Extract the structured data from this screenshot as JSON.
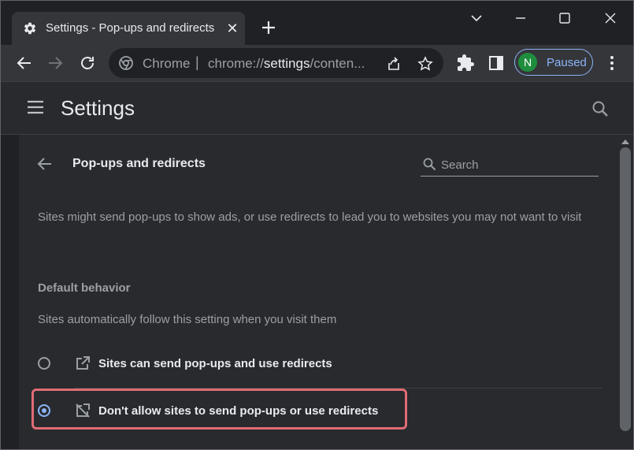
{
  "tab": {
    "title": "Settings - Pop-ups and redirects"
  },
  "omnibox": {
    "site_label": "Chrome",
    "separator": "|",
    "url_prefix": "chrome://",
    "url_bold": "settings",
    "url_suffix": "/conten..."
  },
  "profile": {
    "initial": "N",
    "status": "Paused"
  },
  "header": {
    "title": "Settings"
  },
  "section": {
    "title": "Pop-ups and redirects",
    "search_placeholder": "Search",
    "description": "Sites might send pop-ups to show ads, or use redirects to lead you to websites you may not want to visit",
    "default_heading": "Default behavior",
    "default_description": "Sites automatically follow this setting when you visit them",
    "options": [
      {
        "label": "Sites can send pop-ups and use redirects",
        "selected": false,
        "icon": "open-in-new-icon"
      },
      {
        "label": "Don't allow sites to send pop-ups or use redirects",
        "selected": true,
        "icon": "popup-blocked-icon"
      }
    ]
  },
  "colors": {
    "accent": "#8ab4f8",
    "highlight": "#e06c75",
    "background": "#202124",
    "surface": "#292a2d"
  }
}
